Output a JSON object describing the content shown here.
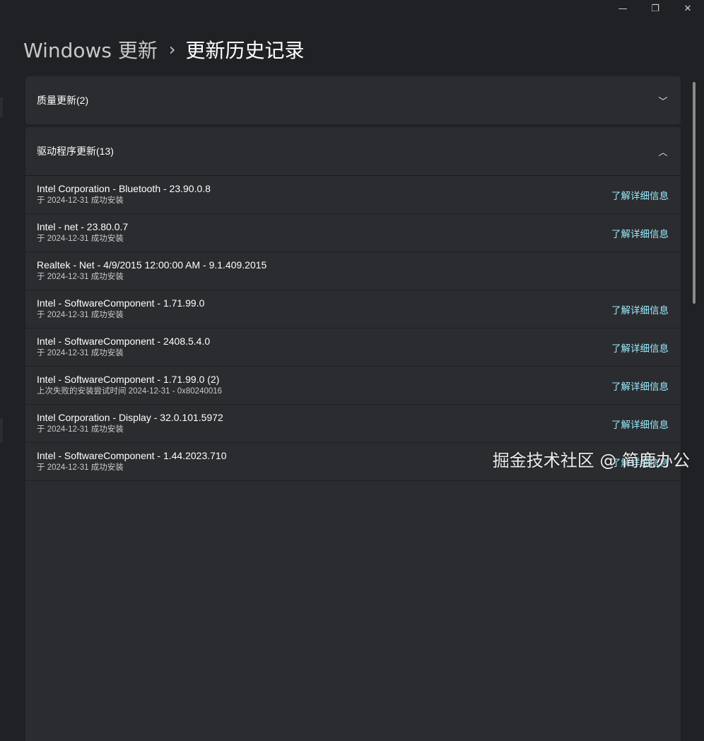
{
  "window": {
    "minimize_glyph": "—",
    "restore_glyph": "❐",
    "close_glyph": "✕"
  },
  "breadcrumb": {
    "parent": "Windows 更新",
    "separator": "›",
    "current": "更新历史记录"
  },
  "sections": {
    "quality": {
      "label": "质量更新(2)",
      "chevron": "﹀",
      "icon": "chevron-down-icon"
    },
    "driver": {
      "label": "驱动程序更新(13)",
      "chevron": "︿",
      "icon": "chevron-up-icon"
    }
  },
  "driver_updates": [
    {
      "title": "Intel Corporation - Bluetooth - 23.90.0.8",
      "status": "于 2024-12-31 成功安装",
      "link": "了解详细信息"
    },
    {
      "title": "Intel - net - 23.80.0.7",
      "status": "于 2024-12-31 成功安装",
      "link": "了解详细信息"
    },
    {
      "title": "Realtek - Net - 4/9/2015 12:00:00 AM - 9.1.409.2015",
      "status": "于 2024-12-31 成功安装",
      "link": ""
    },
    {
      "title": "Intel - SoftwareComponent - 1.71.99.0",
      "status": "于 2024-12-31 成功安装",
      "link": "了解详细信息"
    },
    {
      "title": "Intel - SoftwareComponent - 2408.5.4.0",
      "status": "于 2024-12-31 成功安装",
      "link": "了解详细信息"
    },
    {
      "title": "Intel - SoftwareComponent - 1.71.99.0 (2)",
      "status": "上次失败的安装尝试时间 2024-12-31 - 0x80240016",
      "link": "了解详细信息"
    },
    {
      "title": "Intel Corporation - Display - 32.0.101.5972",
      "status": "于 2024-12-31 成功安装",
      "link": "了解详细信息"
    },
    {
      "title": "Intel - SoftwareComponent - 1.44.2023.710",
      "status": "于 2024-12-31 成功安装",
      "link": "了解详细信息"
    }
  ],
  "watermark": "掘金技术社区 @ 简鹿办公",
  "colors": {
    "background": "#202124",
    "card": "#2b2c2f",
    "link": "#99ebff"
  }
}
